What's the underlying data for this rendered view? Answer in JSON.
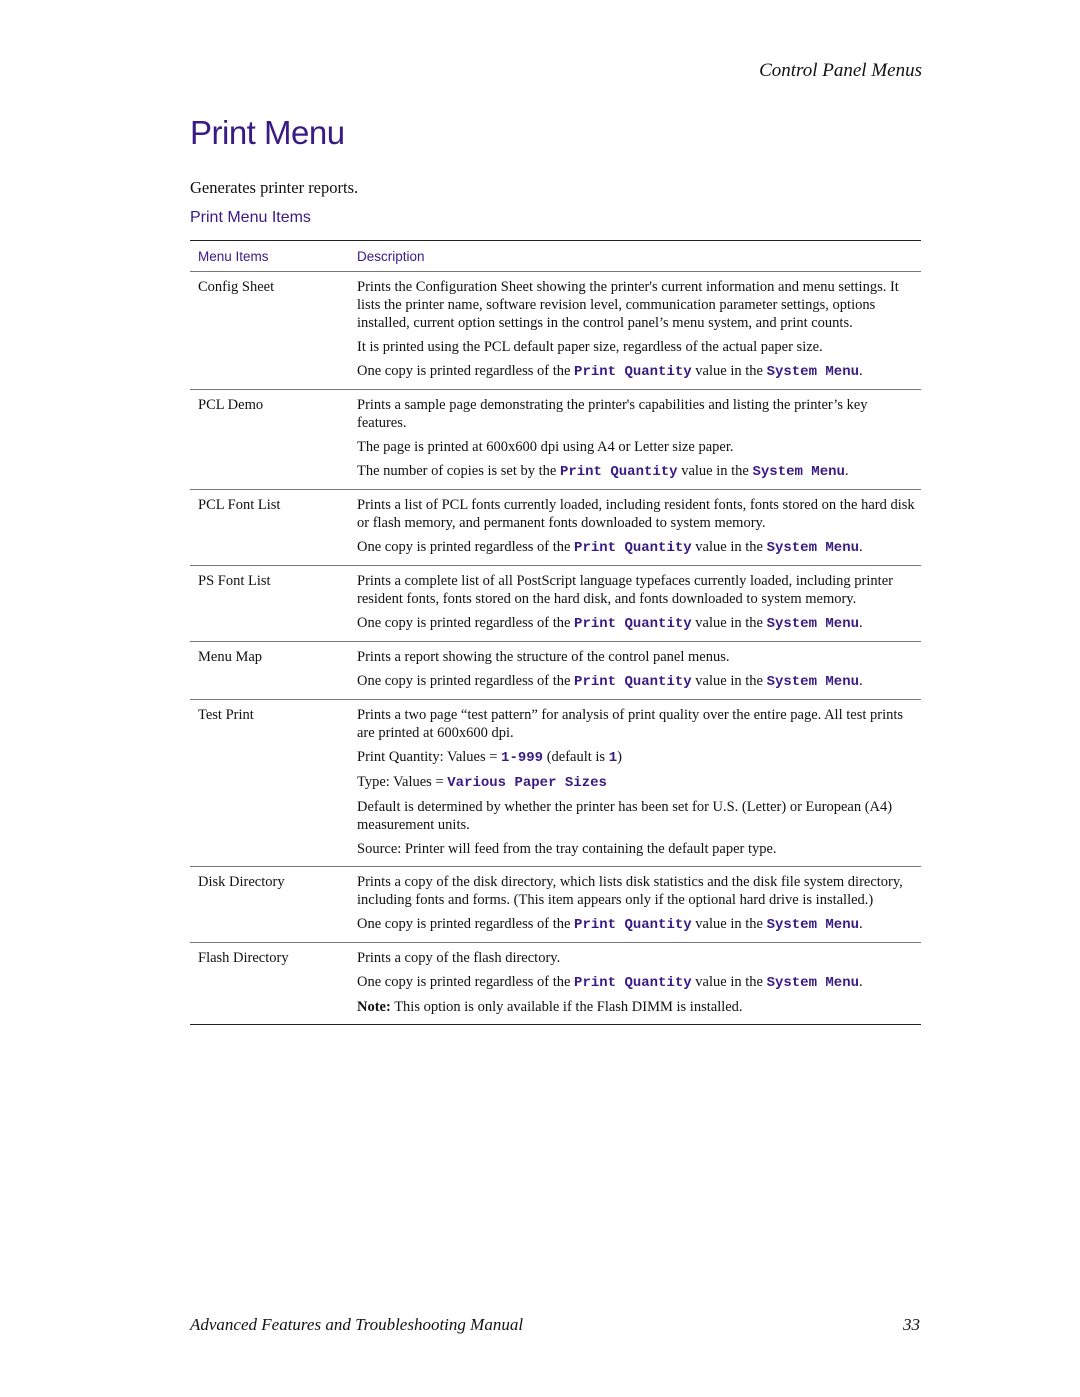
{
  "header": {
    "section": "Control Panel Menus"
  },
  "title": "Print Menu",
  "intro": "Generates printer reports.",
  "subtitle": "Print Menu Items",
  "table": {
    "columns": [
      "Menu Items",
      "Description"
    ],
    "rows": [
      {
        "item": "Config Sheet",
        "paragraphs": [
          [
            {
              "t": "Prints the Configuration Sheet showing the printer's current information and menu settings. It lists the printer name, software revision level, communication parameter settings, options installed, current option settings in the control panel’s menu system, and print counts."
            }
          ],
          [
            {
              "t": "It is printed using the PCL default paper size, regardless of the actual paper size."
            }
          ],
          [
            {
              "t": "One copy is printed regardless of the "
            },
            {
              "t": "Print Quantity",
              "m": true
            },
            {
              "t": " value in the "
            },
            {
              "t": "System Menu",
              "m": true
            },
            {
              "t": "."
            }
          ]
        ]
      },
      {
        "item": "PCL Demo",
        "paragraphs": [
          [
            {
              "t": "Prints a sample page demonstrating the printer's capabilities and listing the printer’s key features."
            }
          ],
          [
            {
              "t": "The page is printed at 600x600 dpi using A4 or Letter size paper."
            }
          ],
          [
            {
              "t": "The number of copies is set by the "
            },
            {
              "t": "Print Quantity",
              "m": true
            },
            {
              "t": " value in the "
            },
            {
              "t": "System Menu",
              "m": true
            },
            {
              "t": "."
            }
          ]
        ]
      },
      {
        "item": "PCL Font List",
        "paragraphs": [
          [
            {
              "t": "Prints a list of PCL fonts currently loaded, including resident fonts, fonts stored on the hard disk or flash memory, and permanent fonts downloaded to system memory."
            }
          ],
          [
            {
              "t": "One copy is printed regardless of the "
            },
            {
              "t": "Print Quantity",
              "m": true
            },
            {
              "t": " value in the "
            },
            {
              "t": "System Menu",
              "m": true
            },
            {
              "t": "."
            }
          ]
        ]
      },
      {
        "item": "PS Font List",
        "paragraphs": [
          [
            {
              "t": "Prints a complete list of all PostScript language typefaces currently loaded, including printer resident fonts, fonts stored on the hard disk, and fonts downloaded to system memory."
            }
          ],
          [
            {
              "t": "One copy is printed regardless of the "
            },
            {
              "t": "Print Quantity",
              "m": true
            },
            {
              "t": " value in the "
            },
            {
              "t": "System Menu",
              "m": true
            },
            {
              "t": "."
            }
          ]
        ]
      },
      {
        "item": "Menu Map",
        "paragraphs": [
          [
            {
              "t": "Prints a report showing the structure of the control panel menus."
            }
          ],
          [
            {
              "t": "One copy is printed regardless of the "
            },
            {
              "t": "Print Quantity",
              "m": true
            },
            {
              "t": " value in the "
            },
            {
              "t": "System Menu",
              "m": true
            },
            {
              "t": "."
            }
          ]
        ]
      },
      {
        "item": "Test Print",
        "paragraphs": [
          [
            {
              "t": "Prints a two page “test pattern” for analysis of print quality over the entire page. All test prints are printed at 600x600 dpi."
            }
          ],
          [
            {
              "t": "Print Quantity: Values = "
            },
            {
              "t": "1-999",
              "m": true
            },
            {
              "t": "  (default is "
            },
            {
              "t": "1",
              "m": true
            },
            {
              "t": ")"
            }
          ],
          [
            {
              "t": "Type: Values = "
            },
            {
              "t": "Various Paper Sizes",
              "m": true
            }
          ],
          [
            {
              "t": "Default is determined by whether the printer has been set for U.S. (Letter) or European (A4) measurement units."
            }
          ],
          [
            {
              "t": "Source: Printer will feed from the tray containing the default paper type."
            }
          ]
        ]
      },
      {
        "item": "Disk Directory",
        "paragraphs": [
          [
            {
              "t": "Prints a copy of the disk directory, which lists disk statistics and the disk file system directory, including fonts and forms. (This item appears only if the optional hard drive is installed.)"
            }
          ],
          [
            {
              "t": "One copy is printed regardless of the "
            },
            {
              "t": "Print Quantity",
              "m": true
            },
            {
              "t": " value in the "
            },
            {
              "t": "System Menu",
              "m": true
            },
            {
              "t": "."
            }
          ]
        ]
      },
      {
        "item": "Flash Directory",
        "paragraphs": [
          [
            {
              "t": "Prints a copy of the flash directory."
            }
          ],
          [
            {
              "t": "One copy is printed regardless of the "
            },
            {
              "t": "Print Quantity",
              "m": true
            },
            {
              "t": " value in the "
            },
            {
              "t": "System Menu",
              "m": true
            },
            {
              "t": "."
            }
          ],
          [
            {
              "t": "Note:",
              "b": true
            },
            {
              "t": " This option is only available if the Flash DIMM is installed."
            }
          ]
        ]
      }
    ]
  },
  "footer": {
    "manual_title": "Advanced Features and Troubleshooting Manual",
    "page_number": "33"
  },
  "colors": {
    "accent": "#3a1a84",
    "text": "#111111"
  }
}
